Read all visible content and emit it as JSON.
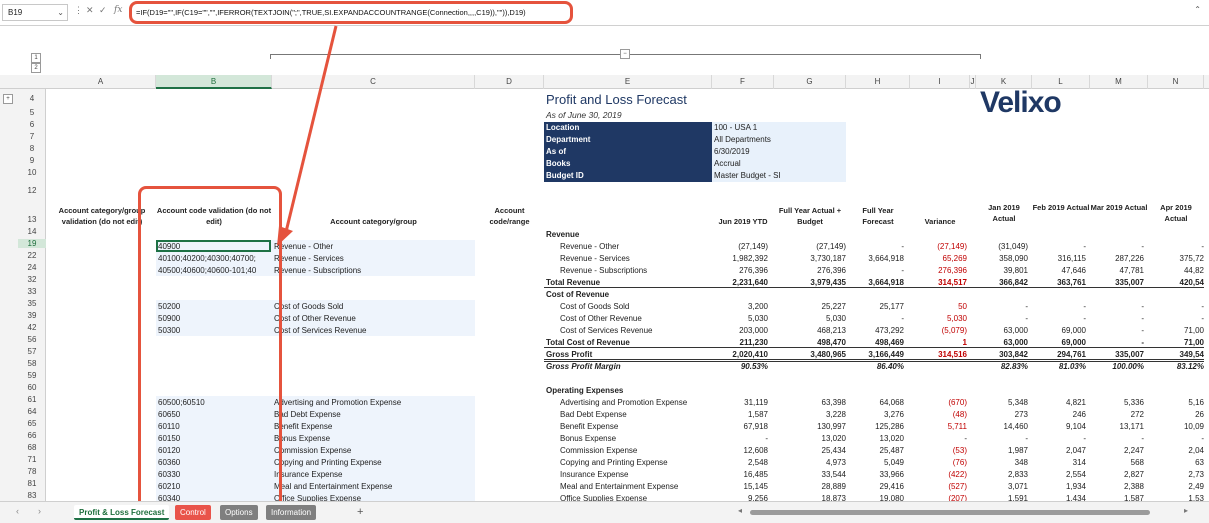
{
  "formula_bar": {
    "name_box": "B19",
    "formula": "=IF(D19=\"\",IF(C19=\"\",\"\",IFERROR(TEXTJOIN(\";\",TRUE,SI.EXPANDACCOUNTRANGE(Connection,,,,C19)),\"\")),D19)"
  },
  "outline": {
    "levels_col": [
      "1",
      "2"
    ],
    "levels_row": [
      "1",
      "2"
    ],
    "expand": "+",
    "collapse": "−"
  },
  "columns": [
    "A",
    "B",
    "C",
    "D",
    "E",
    "F",
    "G",
    "H",
    "I",
    "J",
    "K",
    "L",
    "M",
    "N"
  ],
  "row_numbers": [
    "4",
    "5",
    "6",
    "7",
    "8",
    "9",
    "10",
    "12",
    "13",
    "14",
    "19",
    "22",
    "24",
    "32",
    "33",
    "35",
    "39",
    "42",
    "56",
    "57",
    "58",
    "59",
    "60",
    "61",
    "64",
    "65",
    "66",
    "68",
    "71",
    "78",
    "81",
    "83"
  ],
  "report": {
    "title": "Profit and Loss Forecast",
    "subtitle": "As of June 30, 2019",
    "logo": "Velixo",
    "params": [
      {
        "label": "Location",
        "value": "100 - USA 1"
      },
      {
        "label": "Department",
        "value": "All Departments"
      },
      {
        "label": "As of",
        "value": "6/30/2019"
      },
      {
        "label": "Books",
        "value": "Accrual"
      },
      {
        "label": "Budget ID",
        "value": "Master Budget - SI"
      }
    ]
  },
  "headers": {
    "a": "Account category/group validation (do not edit)",
    "b": "Account code validation (do not edit)",
    "c": "Account category/group",
    "d": "Account code/range",
    "f": "Jun 2019 YTD",
    "g": "Full Year Actual + Budget",
    "h": "Full Year Forecast",
    "i": "Variance",
    "k": "Jan 2019 Actual",
    "l": "Feb 2019 Actual",
    "m": "Mar 2019 Actual",
    "n": "Apr 2019 Actual"
  },
  "rows": [
    {
      "b": "",
      "c": "",
      "e": "Revenue",
      "f": "",
      "g": "",
      "h": "",
      "i": "",
      "k": "",
      "l": "",
      "m": "",
      "n": ""
    },
    {
      "b": "40900",
      "c": "Revenue - Other",
      "e": "Revenue - Other",
      "f": "(27,149)",
      "g": "(27,149)",
      "h": "-",
      "i": "(27,149)",
      "k": "(31,049)",
      "l": "-",
      "m": "-",
      "n": "-"
    },
    {
      "b": "40100;40200;40300;40700;",
      "c": "Revenue - Services",
      "e": "Revenue - Services",
      "f": "1,982,392",
      "g": "3,730,187",
      "h": "3,664,918",
      "i": "65,269",
      "k": "358,090",
      "l": "316,115",
      "m": "287,226",
      "n": "375,72"
    },
    {
      "b": "40500;40600;40600-101;40",
      "c": "Revenue - Subscriptions",
      "e": "Revenue - Subscriptions",
      "f": "276,396",
      "g": "276,396",
      "h": "-",
      "i": "276,396",
      "k": "39,801",
      "l": "47,646",
      "m": "47,781",
      "n": "44,82"
    },
    {
      "b": "",
      "c": "",
      "e": "Total Revenue",
      "f": "2,231,640",
      "g": "3,979,435",
      "h": "3,664,918",
      "i": "314,517",
      "k": "366,842",
      "l": "363,761",
      "m": "335,007",
      "n": "420,54"
    },
    {
      "b": "",
      "c": "",
      "e": "Cost of Revenue",
      "f": "",
      "g": "",
      "h": "",
      "i": "",
      "k": "",
      "l": "",
      "m": "",
      "n": ""
    },
    {
      "b": "50200",
      "c": "Cost of Goods Sold",
      "e": "Cost of Goods Sold",
      "f": "3,200",
      "g": "25,227",
      "h": "25,177",
      "i": "50",
      "k": "-",
      "l": "-",
      "m": "-",
      "n": "-"
    },
    {
      "b": "50900",
      "c": "Cost of Other Revenue",
      "e": "Cost of Other Revenue",
      "f": "5,030",
      "g": "5,030",
      "h": "-",
      "i": "5,030",
      "k": "-",
      "l": "-",
      "m": "-",
      "n": "-"
    },
    {
      "b": "50300",
      "c": "Cost of Services Revenue",
      "e": "Cost of Services Revenue",
      "f": "203,000",
      "g": "468,213",
      "h": "473,292",
      "i": "(5,079)",
      "k": "63,000",
      "l": "69,000",
      "m": "-",
      "n": "71,00"
    },
    {
      "b": "",
      "c": "",
      "e": "Total Cost of Revenue",
      "f": "211,230",
      "g": "498,470",
      "h": "498,469",
      "i": "1",
      "k": "63,000",
      "l": "69,000",
      "m": "-",
      "n": "71,00"
    },
    {
      "b": "",
      "c": "",
      "e": "Gross Profit",
      "f": "2,020,410",
      "g": "3,480,965",
      "h": "3,166,449",
      "i": "314,516",
      "k": "303,842",
      "l": "294,761",
      "m": "335,007",
      "n": "349,54"
    },
    {
      "b": "",
      "c": "",
      "e": "Gross Profit Margin",
      "f": "90.53%",
      "g": "",
      "h": "86.40%",
      "i": "",
      "k": "82.83%",
      "l": "81.03%",
      "m": "100.00%",
      "n": "83.12%"
    },
    {
      "b": "",
      "c": "",
      "e": "",
      "f": "",
      "g": "",
      "h": "",
      "i": "",
      "k": "",
      "l": "",
      "m": "",
      "n": ""
    },
    {
      "b": "",
      "c": "",
      "e": "Operating Expenses",
      "f": "",
      "g": "",
      "h": "",
      "i": "",
      "k": "",
      "l": "",
      "m": "",
      "n": ""
    },
    {
      "b": "60500;60510",
      "c": "Advertising and Promotion Expense",
      "e": "Advertising and Promotion Expense",
      "f": "31,119",
      "g": "63,398",
      "h": "64,068",
      "i": "(670)",
      "k": "5,348",
      "l": "4,821",
      "m": "5,336",
      "n": "5,16"
    },
    {
      "b": "60650",
      "c": "Bad Debt Expense",
      "e": "Bad Debt Expense",
      "f": "1,587",
      "g": "3,228",
      "h": "3,276",
      "i": "(48)",
      "k": "273",
      "l": "246",
      "m": "272",
      "n": "26"
    },
    {
      "b": "60110",
      "c": "Benefit Expense",
      "e": "Benefit Expense",
      "f": "67,918",
      "g": "130,997",
      "h": "125,286",
      "i": "5,711",
      "k": "14,460",
      "l": "9,104",
      "m": "13,171",
      "n": "10,09"
    },
    {
      "b": "60150",
      "c": "Bonus Expense",
      "e": "Bonus Expense",
      "f": "-",
      "g": "13,020",
      "h": "13,020",
      "i": "-",
      "k": "-",
      "l": "-",
      "m": "-",
      "n": "-"
    },
    {
      "b": "60120",
      "c": "Commission Expense",
      "e": "Commission Expense",
      "f": "12,608",
      "g": "25,434",
      "h": "25,487",
      "i": "(53)",
      "k": "1,987",
      "l": "2,047",
      "m": "2,247",
      "n": "2,04"
    },
    {
      "b": "60360",
      "c": "Copying and Printing Expense",
      "e": "Copying and Printing Expense",
      "f": "2,548",
      "g": "4,973",
      "h": "5,049",
      "i": "(76)",
      "k": "348",
      "l": "314",
      "m": "568",
      "n": "63"
    },
    {
      "b": "60330",
      "c": "Insurance Expense",
      "e": "Insurance Expense",
      "f": "16,485",
      "g": "33,544",
      "h": "33,966",
      "i": "(422)",
      "k": "2,833",
      "l": "2,554",
      "m": "2,827",
      "n": "2,73"
    },
    {
      "b": "60210",
      "c": "Meal and Entertainment Expense",
      "e": "Meal and Entertainment Expense",
      "f": "15,145",
      "g": "28,889",
      "h": "29,416",
      "i": "(527)",
      "k": "3,071",
      "l": "1,934",
      "m": "2,388",
      "n": "2,49"
    },
    {
      "b": "60340",
      "c": "Office Supplies Expense",
      "e": "Office Supplies Expense",
      "f": "9,256",
      "g": "18,873",
      "h": "19,080",
      "i": "(207)",
      "k": "1,591",
      "l": "1,434",
      "m": "1,587",
      "n": "1,53"
    }
  ],
  "tabs": [
    "Profit & Loss Forecast",
    "Control",
    "Options",
    "Information"
  ],
  "tab_add": "+",
  "colors": {
    "accent": "#1e7145",
    "navy": "#1f3864",
    "highlight": "#e5533d",
    "negative": "#c00000"
  }
}
